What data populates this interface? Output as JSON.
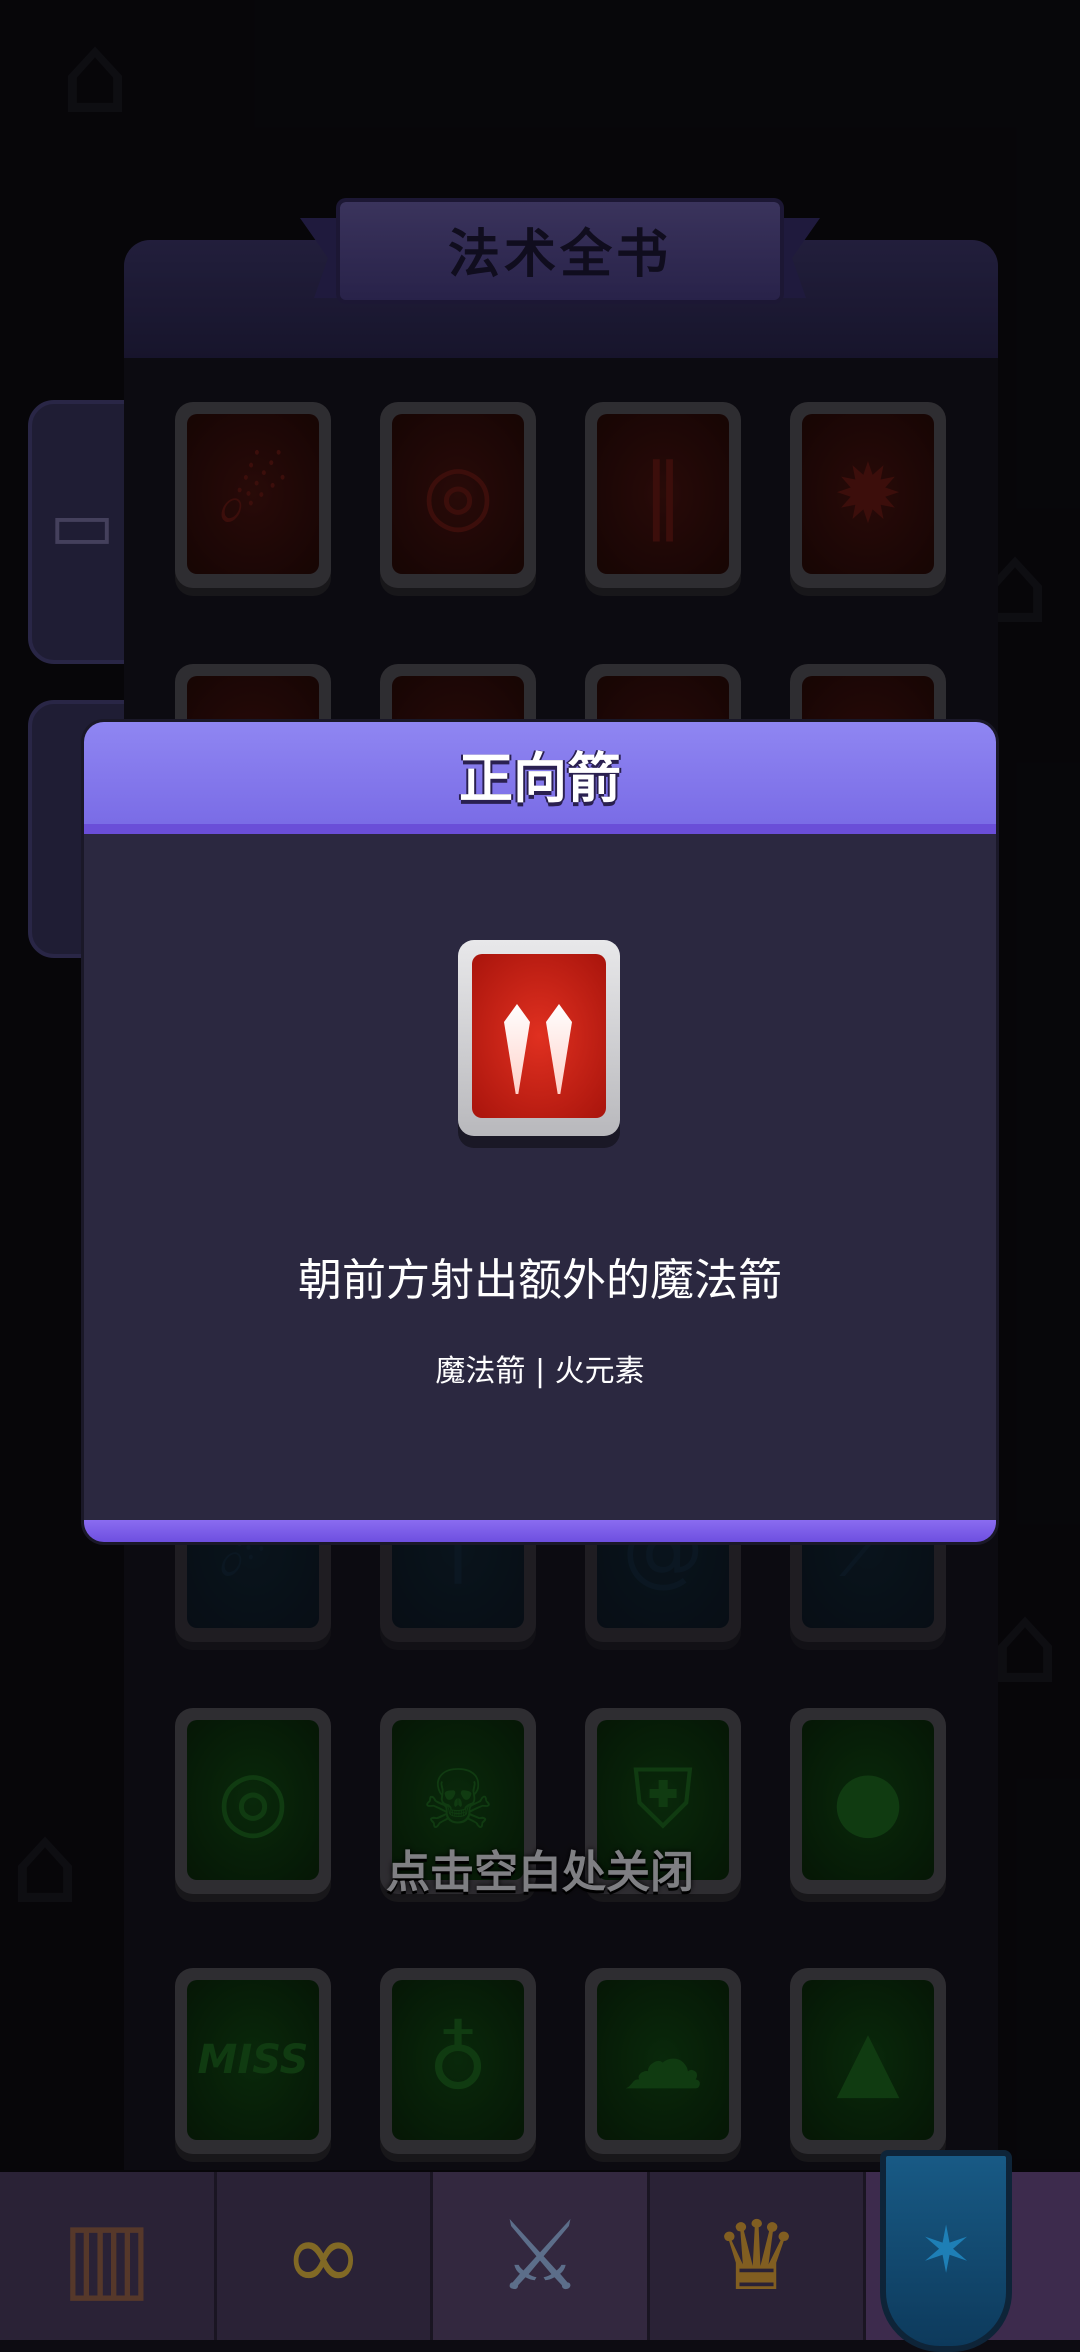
{
  "book": {
    "title": "法术全书",
    "rows": [
      {
        "color": "red",
        "icons": [
          "comet-icon",
          "orbit-icon",
          "fang-icon",
          "fire-shield-icon"
        ]
      },
      {
        "color": "red",
        "icons": [
          "ghost-icon",
          "spike-icon",
          "flame-icon",
          "heart-icon"
        ]
      },
      {
        "color": "blue",
        "icons": [
          "meteor-icon",
          "dagger-icon",
          "swirl-icon",
          "slash-icon"
        ]
      },
      {
        "color": "green",
        "icons": [
          "orbit-icon",
          "skull-chain-icon",
          "skull-shield-icon",
          "bomb-icon"
        ]
      },
      {
        "color": "green",
        "icons": [
          "miss-icon",
          "poison-bottle-icon",
          "sheep-icon",
          "cones-icon"
        ]
      }
    ],
    "miss_text_top": "MISS",
    "miss_text_bottom": "MISS"
  },
  "modal": {
    "title": "正向箭",
    "skill_icon": "twin-fang-icon",
    "description": "朝前方射出额外的魔法箭",
    "tags": "魔法箭 | 火元素"
  },
  "close_hint": "点击空白处关闭",
  "nav": {
    "items": [
      {
        "icon": "cabinet-icon",
        "active": false
      },
      {
        "icon": "infinity-icon",
        "active": false
      },
      {
        "icon": "crossed-swords-icon",
        "active": true
      },
      {
        "icon": "trophy-icon",
        "active": false
      },
      {
        "icon": "banner-icon",
        "active": false
      }
    ]
  },
  "colors": {
    "modal_header": "#8f86f2",
    "modal_body": "#2b2840",
    "card_red": "#a8140c",
    "accent_purple": "#6a4ed8"
  }
}
